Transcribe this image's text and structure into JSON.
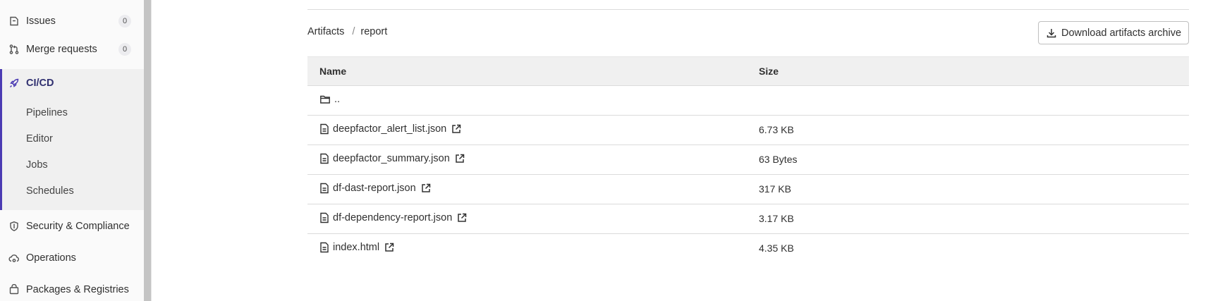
{
  "sidebar": {
    "issues": {
      "label": "Issues",
      "count": "0"
    },
    "merge_requests": {
      "label": "Merge requests",
      "count": "0"
    },
    "cicd": {
      "label": "CI/CD",
      "items": [
        {
          "label": "Pipelines"
        },
        {
          "label": "Editor"
        },
        {
          "label": "Jobs"
        },
        {
          "label": "Schedules"
        }
      ]
    },
    "security": {
      "label": "Security & Compliance"
    },
    "operations": {
      "label": "Operations"
    },
    "packages": {
      "label": "Packages & Registries"
    }
  },
  "breadcrumb": {
    "root": "Artifacts",
    "separator": "/",
    "current": "report"
  },
  "download_button": {
    "label": "Download artifacts archive"
  },
  "table": {
    "columns": {
      "name": "Name",
      "size": "Size"
    },
    "parent_dir": "..",
    "rows": [
      {
        "name": "deepfactor_alert_list.json",
        "size": "6.73 KB"
      },
      {
        "name": "deepfactor_summary.json",
        "size": "63 Bytes"
      },
      {
        "name": "df-dast-report.json",
        "size": "317 KB"
      },
      {
        "name": "df-dependency-report.json",
        "size": "3.17 KB"
      },
      {
        "name": "index.html",
        "size": "4.35 KB"
      }
    ]
  },
  "colors": {
    "accent": "#4b3bb3",
    "sidebar_bg": "#fafafa",
    "header_bg": "#f0f0f0"
  }
}
